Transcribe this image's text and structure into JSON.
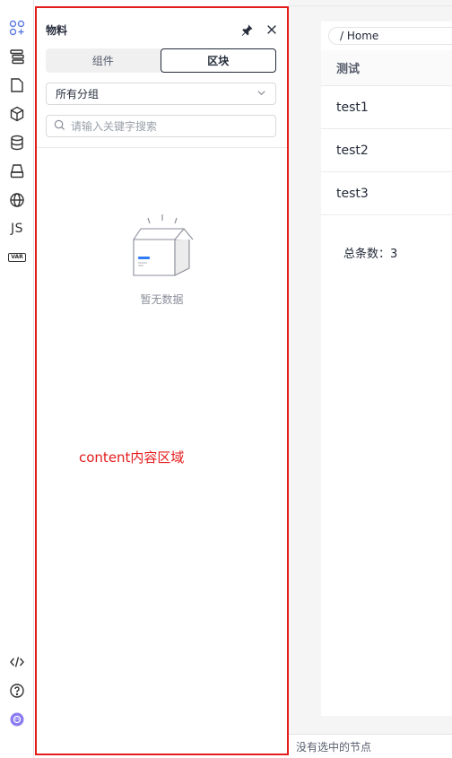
{
  "activity_bar": {
    "items": [
      {
        "name": "materials-icon",
        "active": true
      },
      {
        "name": "outline-icon"
      },
      {
        "name": "page-icon"
      },
      {
        "name": "block-icon"
      },
      {
        "name": "datasource-icon"
      },
      {
        "name": "bridge-icon"
      },
      {
        "name": "i18n-icon"
      },
      {
        "name": "script-icon",
        "label": "JS"
      },
      {
        "name": "state-icon",
        "label": "VAR"
      }
    ],
    "bottom": [
      {
        "name": "code-icon"
      },
      {
        "name": "help-icon"
      },
      {
        "name": "robot-icon"
      }
    ],
    "accent": "#5e7ce0"
  },
  "panel": {
    "title": "物料",
    "tabs": [
      {
        "label": "组件",
        "active": false
      },
      {
        "label": "区块",
        "active": true
      }
    ],
    "group_select": {
      "value": "所有分组"
    },
    "search": {
      "placeholder": "请输入关键字搜索"
    },
    "empty_text": "暂无数据",
    "annotation": "content内容区域",
    "border_color": "#e51c1c"
  },
  "canvas": {
    "breadcrumb": "/ Home",
    "table": {
      "header": "测试",
      "rows": [
        "test1",
        "test2",
        "test3"
      ]
    },
    "total_text": "总条数：3"
  },
  "status_bar": {
    "text": "没有选中的节点"
  }
}
